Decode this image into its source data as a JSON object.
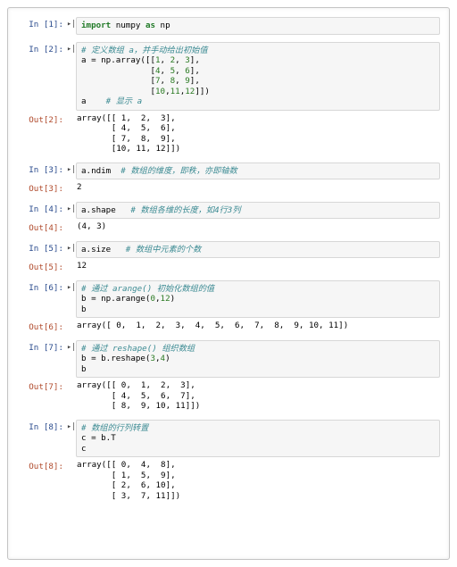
{
  "cells": {
    "c1": {
      "in_prompt": "In [1]:",
      "code_html": "<span class=\"kw\">import</span> numpy <span class=\"kw2\">as</span> np"
    },
    "c2": {
      "in_prompt": "In [2]:",
      "code_html": "<span class=\"cmt\"># 定义数组 a，并手动给出初始值</span>\na = np.array([[<span class=\"num\">1</span>, <span class=\"num\">2</span>, <span class=\"num\">3</span>],\n              [<span class=\"num\">4</span>, <span class=\"num\">5</span>, <span class=\"num\">6</span>],\n              [<span class=\"num\">7</span>, <span class=\"num\">8</span>, <span class=\"num\">9</span>],\n              [<span class=\"num\">10</span>,<span class=\"num\">11</span>,<span class=\"num\">12</span>]])\na    <span class=\"cmt\"># 显示 a</span>",
      "out_prompt": "Out[2]:",
      "out_text": "array([[ 1,  2,  3],\n       [ 4,  5,  6],\n       [ 7,  8,  9],\n       [10, 11, 12]])"
    },
    "c3": {
      "in_prompt": "In [3]:",
      "code_html": "a.ndim  <span class=\"cmt\"># 数组的维度，即秩，亦即轴数</span>",
      "out_prompt": "Out[3]:",
      "out_text": "2"
    },
    "c4": {
      "in_prompt": "In [4]:",
      "code_html": "a.shape   <span class=\"cmt\"># 数组各维的长度，如4行3列</span>",
      "out_prompt": "Out[4]:",
      "out_text": "(4, 3)"
    },
    "c5": {
      "in_prompt": "In [5]:",
      "code_html": "a.size   <span class=\"cmt\"># 数组中元素的个数</span>",
      "out_prompt": "Out[5]:",
      "out_text": "12"
    },
    "c6": {
      "in_prompt": "In [6]:",
      "code_html": "<span class=\"cmt\"># 通过 <span class=\"fn\">arange()</span> 初始化数组的值</span>\nb = np.arange(<span class=\"num\">0</span>,<span class=\"num\">12</span>)\nb",
      "out_prompt": "Out[6]:",
      "out_text": "array([ 0,  1,  2,  3,  4,  5,  6,  7,  8,  9, 10, 11])"
    },
    "c7": {
      "in_prompt": "In [7]:",
      "code_html": "<span class=\"cmt\"># 通过 <span class=\"fn\">reshape()</span> 组织数组</span>\nb = b.reshape(<span class=\"num\">3</span>,<span class=\"num\">4</span>)\nb",
      "out_prompt": "Out[7]:",
      "out_text": "array([[ 0,  1,  2,  3],\n       [ 4,  5,  6,  7],\n       [ 8,  9, 10, 11]])"
    },
    "c8": {
      "in_prompt": "In [8]:",
      "code_html": "<span class=\"cmt\"># 数组的行列转置</span>\nc = b.T\nc",
      "out_prompt": "Out[8]:",
      "out_text": "array([[ 0,  4,  8],\n       [ 1,  5,  9],\n       [ 2,  6, 10],\n       [ 3,  7, 11]])"
    }
  },
  "run_glyph": "▸|"
}
